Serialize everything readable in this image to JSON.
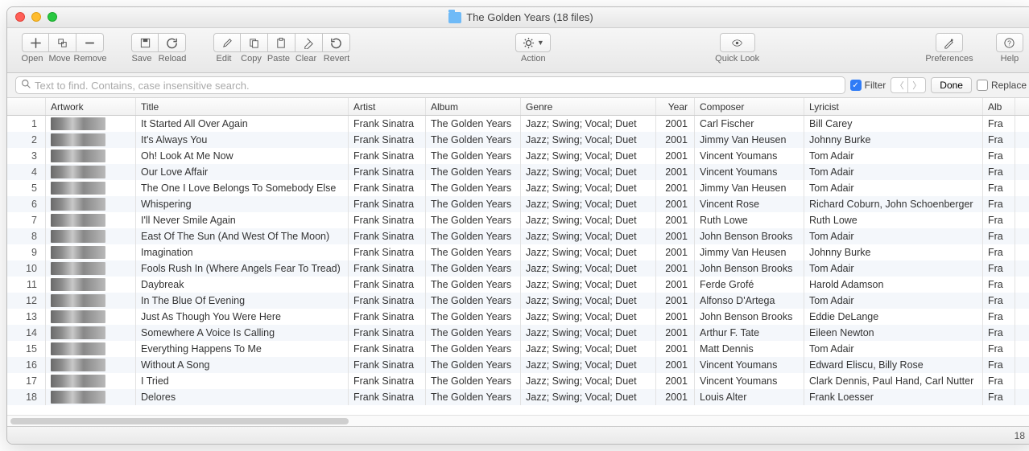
{
  "window": {
    "title": "The Golden Years (18 files)"
  },
  "toolbar": {
    "open": "Open",
    "move": "Move",
    "remove": "Remove",
    "save": "Save",
    "reload": "Reload",
    "edit": "Edit",
    "copy": "Copy",
    "paste": "Paste",
    "clear": "Clear",
    "revert": "Revert",
    "action": "Action",
    "quicklook": "Quick Look",
    "preferences": "Preferences",
    "help": "Help"
  },
  "search": {
    "placeholder": "Text to find. Contains, case insensitive search."
  },
  "filterbar": {
    "filter": "Filter",
    "done": "Done",
    "replace": "Replace"
  },
  "columns": {
    "artwork": "Artwork",
    "title": "Title",
    "artist": "Artist",
    "album": "Album",
    "genre": "Genre",
    "year": "Year",
    "composer": "Composer",
    "lyricist": "Lyricist",
    "alb": "Alb"
  },
  "shared": {
    "artist": "Frank Sinatra",
    "album": "The Golden Years",
    "genre": "Jazz; Swing; Vocal; Duet",
    "year": "2001",
    "alb": "Fra"
  },
  "rows": [
    {
      "n": "1",
      "title": "It Started All Over Again",
      "composer": "Carl Fischer",
      "lyricist": "Bill Carey"
    },
    {
      "n": "2",
      "title": "It's Always You",
      "composer": "Jimmy Van Heusen",
      "lyricist": "Johnny Burke"
    },
    {
      "n": "3",
      "title": "Oh! Look At Me Now",
      "composer": "Vincent Youmans",
      "lyricist": "Tom Adair"
    },
    {
      "n": "4",
      "title": "Our Love Affair",
      "composer": "Vincent Youmans",
      "lyricist": "Tom Adair"
    },
    {
      "n": "5",
      "title": "The One I Love Belongs To Somebody Else",
      "composer": "Jimmy Van Heusen",
      "lyricist": "Tom Adair"
    },
    {
      "n": "6",
      "title": "Whispering",
      "composer": "Vincent Rose",
      "lyricist": "Richard Coburn, John Schoenberger"
    },
    {
      "n": "7",
      "title": "I'll Never Smile Again",
      "composer": "Ruth Lowe",
      "lyricist": "Ruth Lowe"
    },
    {
      "n": "8",
      "title": "East Of The Sun (And West Of The Moon)",
      "composer": "John Benson Brooks",
      "lyricist": "Tom Adair"
    },
    {
      "n": "9",
      "title": "Imagination",
      "composer": "Jimmy Van Heusen",
      "lyricist": "Johnny Burke"
    },
    {
      "n": "10",
      "title": "Fools Rush In (Where Angels Fear To Tread)",
      "composer": "John Benson Brooks",
      "lyricist": "Tom Adair"
    },
    {
      "n": "11",
      "title": "Daybreak",
      "composer": "Ferde Grofé",
      "lyricist": "Harold Adamson"
    },
    {
      "n": "12",
      "title": "In The Blue Of Evening",
      "composer": "Alfonso D'Artega",
      "lyricist": "Tom Adair"
    },
    {
      "n": "13",
      "title": "Just As Though You Were Here",
      "composer": "John Benson Brooks",
      "lyricist": "Eddie DeLange"
    },
    {
      "n": "14",
      "title": "Somewhere A Voice Is Calling",
      "composer": "Arthur F. Tate",
      "lyricist": "Eileen Newton"
    },
    {
      "n": "15",
      "title": "Everything Happens To Me",
      "composer": "Matt Dennis",
      "lyricist": "Tom Adair"
    },
    {
      "n": "16",
      "title": "Without A Song",
      "composer": "Vincent Youmans",
      "lyricist": "Edward Eliscu, Billy Rose"
    },
    {
      "n": "17",
      "title": "I Tried",
      "composer": "Vincent Youmans",
      "lyricist": "Clark Dennis, Paul Hand, Carl Nutter"
    },
    {
      "n": "18",
      "title": "Delores",
      "composer": "Louis Alter",
      "lyricist": "Frank Loesser"
    }
  ],
  "status": {
    "count": "18"
  }
}
